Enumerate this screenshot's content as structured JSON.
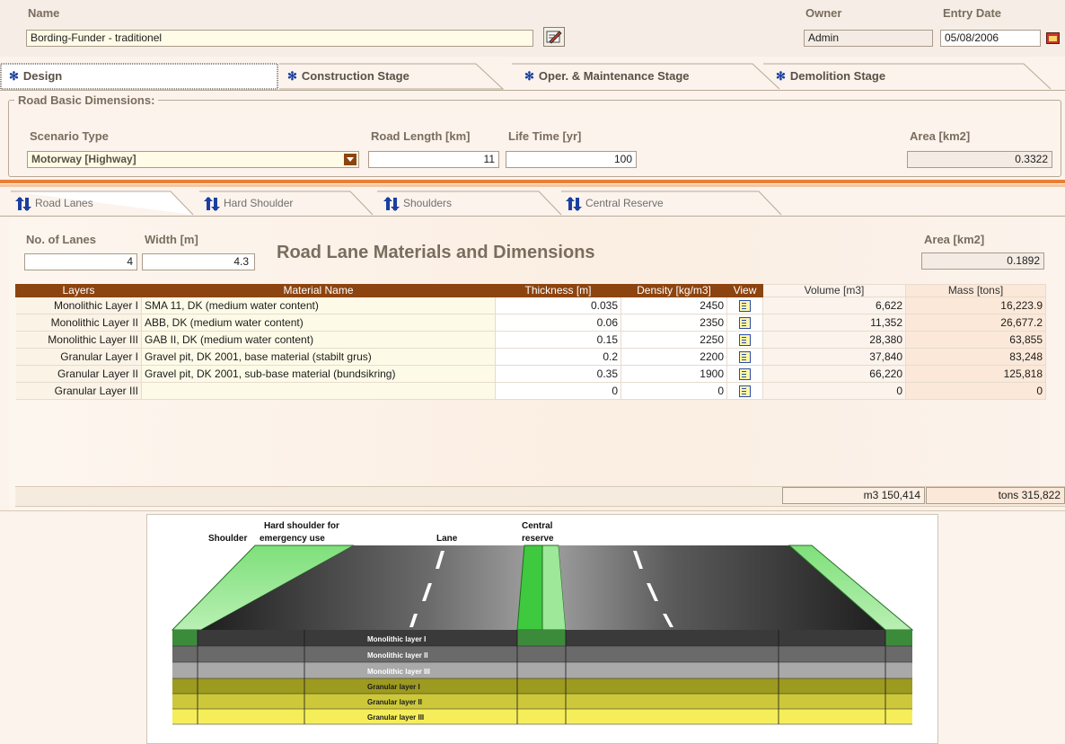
{
  "header": {
    "name_label": "Name",
    "name_value": "Bording-Funder - traditionel",
    "owner_label": "Owner",
    "owner_value": "Admin",
    "entry_date_label": "Entry Date",
    "entry_date_value": "05/08/2006"
  },
  "stage_tabs": [
    {
      "label": "Design",
      "active": true
    },
    {
      "label": "Construction Stage"
    },
    {
      "label": "Oper. & Maintenance Stage"
    },
    {
      "label": "Demolition Stage"
    }
  ],
  "basic": {
    "group_title": "Road Basic Dimensions:",
    "scenario_label": "Scenario Type",
    "scenario_value": "Motorway [Highway]",
    "length_label": "Road Length [km]",
    "length_value": "11",
    "life_label": "Life Time [yr]",
    "life_value": "100",
    "area_label": "Area [km2]",
    "area_value": "0.3322"
  },
  "sub_tabs": [
    {
      "label": "Road Lanes",
      "active": true
    },
    {
      "label": "Hard Shoulder"
    },
    {
      "label": "Shoulders"
    },
    {
      "label": "Central Reserve"
    }
  ],
  "lanes": {
    "lanes_label": "No. of Lanes",
    "lanes_value": "4",
    "width_label": "Width [m]",
    "width_value": "4.3",
    "title": "Road Lane Materials and Dimensions",
    "area_label": "Area [km2]",
    "area_value": "0.1892"
  },
  "table": {
    "headers": [
      "Layers",
      "Material Name",
      "Thickness [m]",
      "Density [kg/m3]",
      "View",
      "Volume [m3]",
      "Mass [tons]"
    ],
    "rows": [
      {
        "layer": "Monolithic Layer I",
        "material": "SMA 11, DK (medium water content)",
        "thickness": "0.035",
        "density": "2450",
        "volume": "6,622",
        "mass": "16,223.9"
      },
      {
        "layer": "Monolithic Layer II",
        "material": "ABB, DK (medium water content)",
        "thickness": "0.06",
        "density": "2350",
        "volume": "11,352",
        "mass": "26,677.2"
      },
      {
        "layer": "Monolithic Layer III",
        "material": "GAB II, DK (medium water content)",
        "thickness": "0.15",
        "density": "2250",
        "volume": "28,380",
        "mass": "63,855"
      },
      {
        "layer": "Granular Layer I",
        "material": "Gravel pit, DK 2001, base material (stabilt grus)",
        "thickness": "0.2",
        "density": "2200",
        "volume": "37,840",
        "mass": "83,248"
      },
      {
        "layer": "Granular Layer II",
        "material": "Gravel pit, DK 2001, sub-base material (bundsikring)",
        "thickness": "0.35",
        "density": "1900",
        "volume": "66,220",
        "mass": "125,818"
      },
      {
        "layer": "Granular Layer III",
        "material": "",
        "thickness": "0",
        "density": "0",
        "volume": "0",
        "mass": "0"
      }
    ],
    "total_volume": "m3  150,414",
    "total_mass": "tons  315,822"
  },
  "diagram": {
    "labels": {
      "shoulder": "Shoulder",
      "hard_shoulder_1": "Hard shoulder for",
      "hard_shoulder_2": "emergency use",
      "lane": "Lane",
      "central_1": "Central",
      "central_2": "reserve"
    },
    "layers": [
      "Monolithic layer I",
      "Monolithic layer II",
      "Monolithic layer III",
      "Granular layer I",
      "Granular layer II",
      "Granular layer III"
    ],
    "colors": [
      "#3a3a3a",
      "#6a6a6a",
      "#a9a9a9",
      "#9d9a20",
      "#ccc83a",
      "#f5ee5a"
    ]
  },
  "colors": {
    "accent_orange": "#e8803a",
    "table_header": "#8c4410",
    "tab_star": "#1a3fa0"
  }
}
